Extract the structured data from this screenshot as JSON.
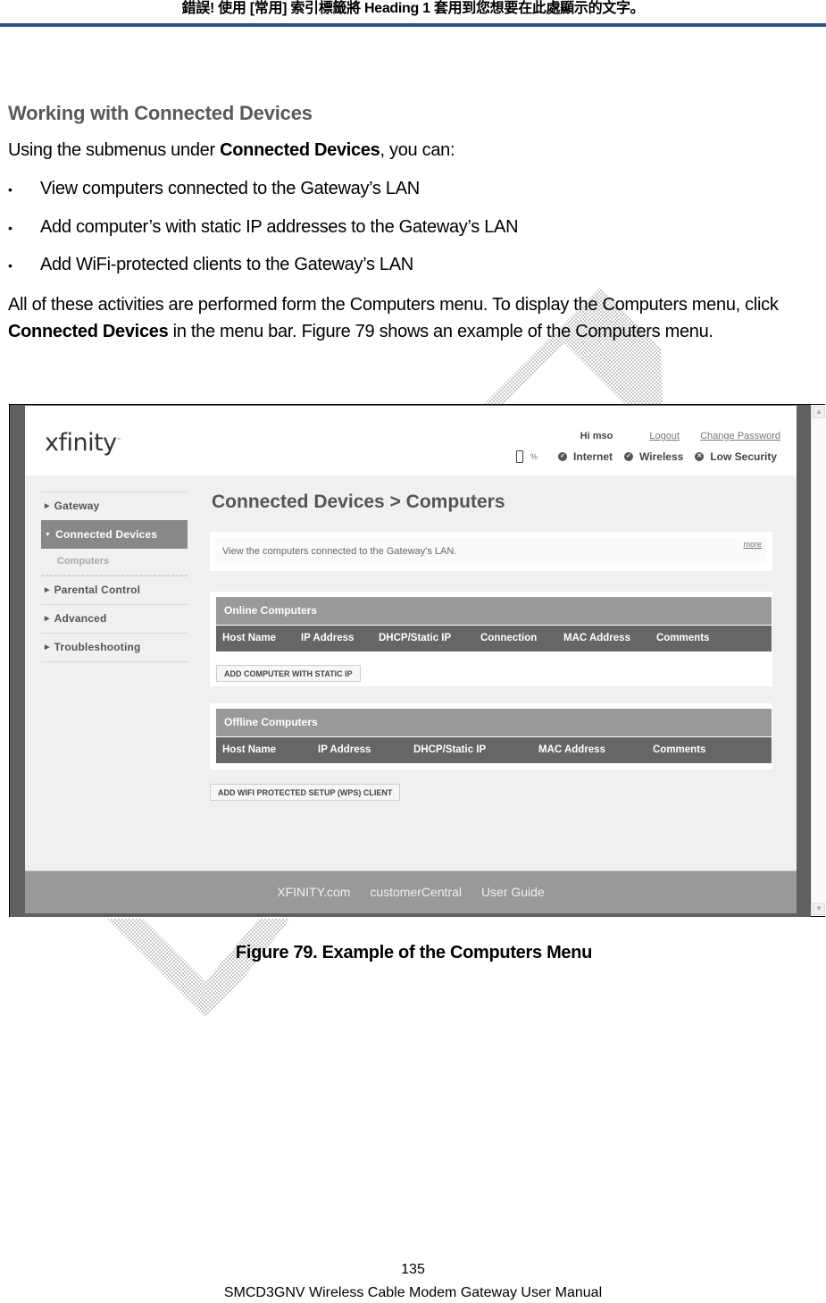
{
  "running_head": "錯誤! 使用 [常用] 索引標籤將 Heading 1 套用到您想要在此處顯示的文字。",
  "section_title": "Working with Connected Devices",
  "intro": {
    "before": "Using the submenus under ",
    "bold": "Connected Devices",
    "after": ", you can:"
  },
  "bullets": [
    "View computers connected to the Gateway’s LAN",
    "Add computer’s with static IP addresses to the Gateway’s LAN",
    "Add WiFi-protected clients to the Gateway’s LAN"
  ],
  "body": {
    "part1": "All of these activities are performed form the Computers menu. To display the Computers menu, click ",
    "bold": "Connected Devices",
    "part2": " in the menu bar. Figure 79 shows an example of the Computers menu."
  },
  "figure": {
    "logo": "xfinity",
    "logo_tm": "™",
    "greeting": "Hi mso",
    "logout": "Logout",
    "change_password": "Change Password",
    "battery_pct": "%",
    "status": [
      {
        "icon": "check-icon",
        "glyph": "✓",
        "label": "Internet"
      },
      {
        "icon": "check-icon",
        "glyph": "✓",
        "label": "Wireless"
      },
      {
        "icon": "x-icon",
        "glyph": "✕",
        "label": "Low Security"
      }
    ],
    "nav": [
      {
        "label": "Gateway",
        "arrow": "▶"
      },
      {
        "label": "Connected Devices",
        "arrow": "▼",
        "active": true
      },
      {
        "label": "Parental Control",
        "arrow": "▶"
      },
      {
        "label": "Advanced",
        "arrow": "▶"
      },
      {
        "label": "Troubleshooting",
        "arrow": "▶"
      }
    ],
    "nav_sub": "Computers",
    "page_title": "Connected Devices > Computers",
    "description": "View the computers connected to the Gateway's LAN.",
    "more": "more",
    "online_table": {
      "title": "Online Computers",
      "columns": [
        "Host Name",
        "IP Address",
        "DHCP/Static IP",
        "Connection",
        "MAC Address",
        "Comments"
      ],
      "button": "ADD COMPUTER WITH STATIC IP"
    },
    "offline_table": {
      "title": "Offline Computers",
      "columns": [
        "Host Name",
        "IP Address",
        "DHCP/Static IP",
        "MAC Address",
        "Comments"
      ]
    },
    "wps_button": "ADD WIFI PROTECTED SETUP (WPS) CLIENT",
    "footer_links": [
      "XFINITY.com",
      "customerCentral",
      "User Guide"
    ],
    "scroll_up": "▲",
    "scroll_down": "▼"
  },
  "caption": "Figure 79. Example of the Computers Menu",
  "page_number": "135",
  "manual_title": "SMCD3GNV Wireless Cable Modem Gateway User Manual",
  "colors": {
    "head_rule": "#2b5580",
    "section_title": "#595959",
    "nav_active": "#888888",
    "table_title": "#999999",
    "table_header": "#666666",
    "frame_dark": "#606060"
  }
}
